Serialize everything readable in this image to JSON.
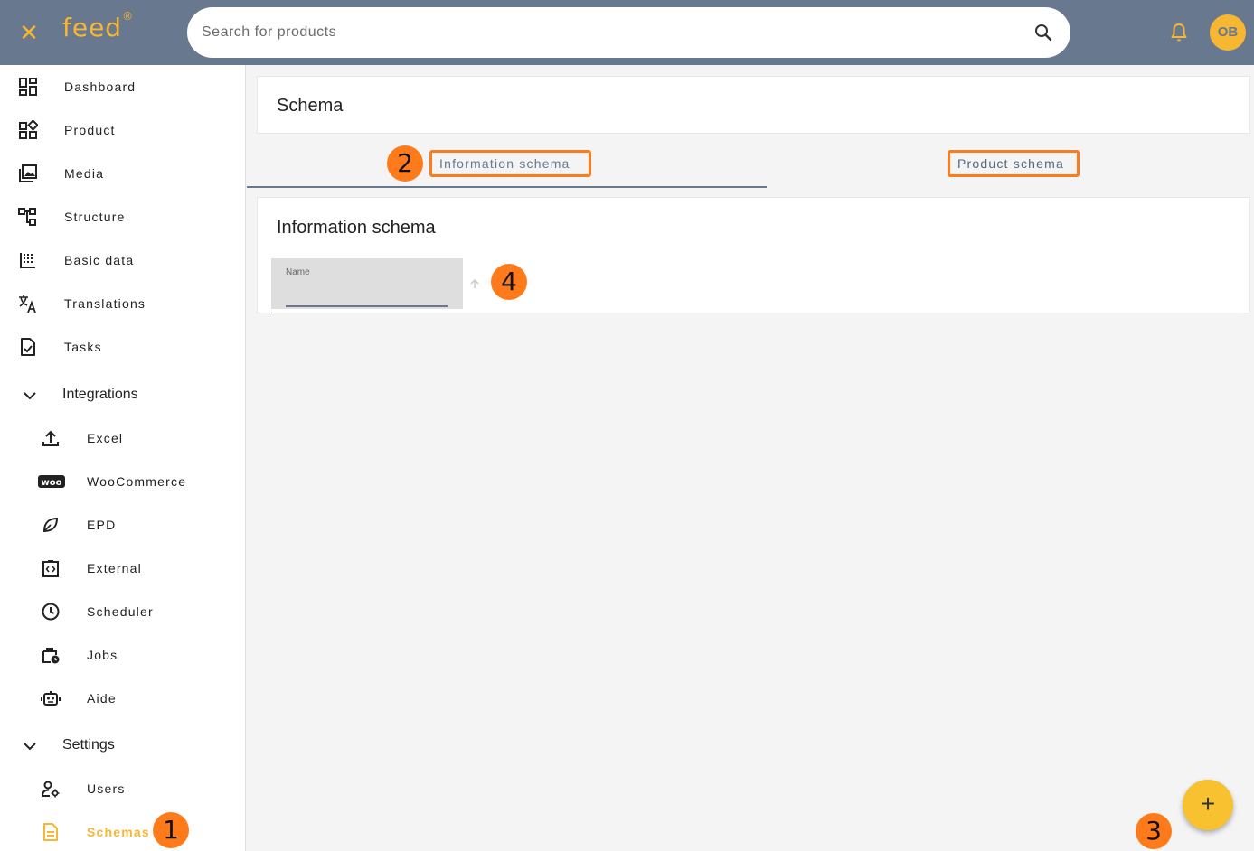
{
  "app": {
    "logo": "feed",
    "logo_mark": "®"
  },
  "header": {
    "search_placeholder": "Search for products",
    "avatar_initials": "OB",
    "accent": "#f7b733",
    "bar_color": "#67788f"
  },
  "sidebar": {
    "items": [
      {
        "label": "Dashboard",
        "icon": "dashboard-icon"
      },
      {
        "label": "Product",
        "icon": "product-icon"
      },
      {
        "label": "Media",
        "icon": "media-icon"
      },
      {
        "label": "Structure",
        "icon": "structure-icon"
      },
      {
        "label": "Basic data",
        "icon": "basic-data-icon"
      },
      {
        "label": "Translations",
        "icon": "translate-icon"
      },
      {
        "label": "Tasks",
        "icon": "tasks-icon"
      }
    ],
    "groups": {
      "integrations": {
        "label": "Integrations",
        "items": [
          {
            "label": "Excel",
            "icon": "upload-icon"
          },
          {
            "label": "WooCommerce",
            "icon": "woo-icon"
          },
          {
            "label": "EPD",
            "icon": "leaf-icon"
          },
          {
            "label": "External",
            "icon": "code-icon"
          },
          {
            "label": "Scheduler",
            "icon": "clock-icon"
          },
          {
            "label": "Jobs",
            "icon": "jobs-icon"
          },
          {
            "label": "Aide",
            "icon": "robot-icon"
          }
        ]
      },
      "settings": {
        "label": "Settings",
        "items": [
          {
            "label": "Users",
            "icon": "user-settings-icon"
          },
          {
            "label": "Schemas",
            "icon": "document-icon",
            "active": true
          }
        ]
      }
    }
  },
  "main": {
    "page_title": "Schema",
    "tabs": [
      {
        "label": "Information schema",
        "selected": true
      },
      {
        "label": "Product schema",
        "selected": false
      }
    ],
    "panel_title": "Information schema",
    "table": {
      "columns": [
        {
          "label": "Name"
        }
      ]
    },
    "fab_label": "+"
  },
  "annotations": [
    "1",
    "2",
    "3",
    "4"
  ]
}
